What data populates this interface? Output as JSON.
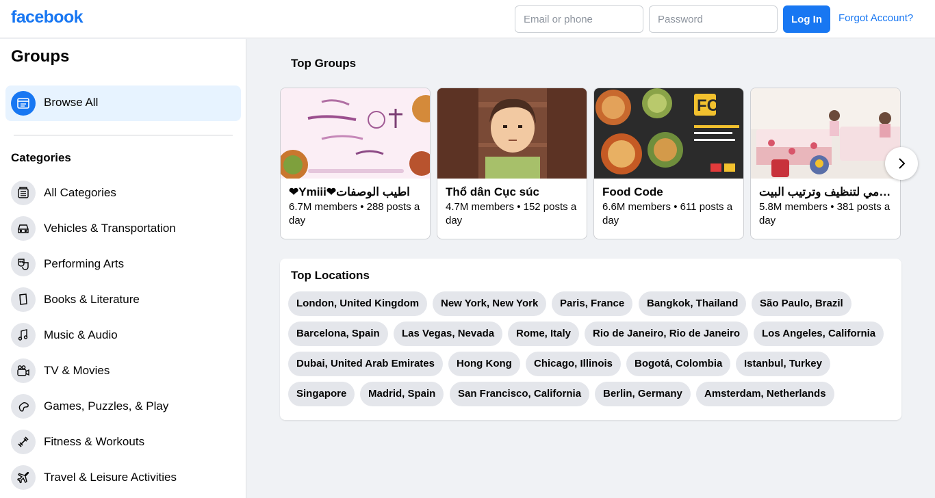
{
  "header": {
    "logo": "facebook",
    "email_placeholder": "Email or phone",
    "password_placeholder": "Password",
    "login_label": "Log In",
    "forgot_label": "Forgot Account?"
  },
  "sidebar": {
    "title": "Groups",
    "browse_all": "Browse All",
    "categories_title": "Categories",
    "categories": [
      {
        "label": "All Categories",
        "icon": "list-icon"
      },
      {
        "label": "Vehicles & Transportation",
        "icon": "car-icon"
      },
      {
        "label": "Performing Arts",
        "icon": "theater-masks-icon"
      },
      {
        "label": "Books & Literature",
        "icon": "book-icon"
      },
      {
        "label": "Music & Audio",
        "icon": "music-note-icon"
      },
      {
        "label": "TV & Movies",
        "icon": "video-camera-icon"
      },
      {
        "label": "Games, Puzzles, & Play",
        "icon": "game-controller-icon"
      },
      {
        "label": "Fitness & Workouts",
        "icon": "dumbbell-icon"
      },
      {
        "label": "Travel & Leisure Activities",
        "icon": "airplane-icon"
      }
    ]
  },
  "top_groups": {
    "title": "Top Groups",
    "groups": [
      {
        "name": "❤Ymiii❤اطيب الوصفات",
        "meta": "6.7M members • 288 posts a day"
      },
      {
        "name": "Thổ dân Cục súc",
        "meta": "4.7M members • 152 posts a day"
      },
      {
        "name": "Food Code",
        "meta": "6.6M members • 611 posts a day"
      },
      {
        "name": "الروتين اليومي لتنظيف وترتيب البيت",
        "meta": "5.8M members • 381 posts a day"
      }
    ]
  },
  "top_locations": {
    "title": "Top Locations",
    "rows": [
      [
        "London, United Kingdom",
        "New York, New York",
        "Paris, France",
        "Bangkok, Thailand",
        "São Paulo, Brazil"
      ],
      [
        "Barcelona, Spain",
        "Las Vegas, Nevada",
        "Rome, Italy",
        "Rio de Janeiro, Rio de Janeiro",
        "Los Angeles, California"
      ],
      [
        "Dubai, United Arab Emirates",
        "Hong Kong",
        "Chicago, Illinois",
        "Bogotá, Colombia",
        "Istanbul, Turkey"
      ],
      [
        "Singapore",
        "Madrid, Spain",
        "San Francisco, California",
        "Berlin, Germany",
        "Amsterdam, Netherlands"
      ]
    ]
  },
  "colors": {
    "brand": "#1877f2",
    "page_bg": "#f0f2f5",
    "chip_bg": "#e4e6eb",
    "selected_bg": "#e7f3ff"
  }
}
